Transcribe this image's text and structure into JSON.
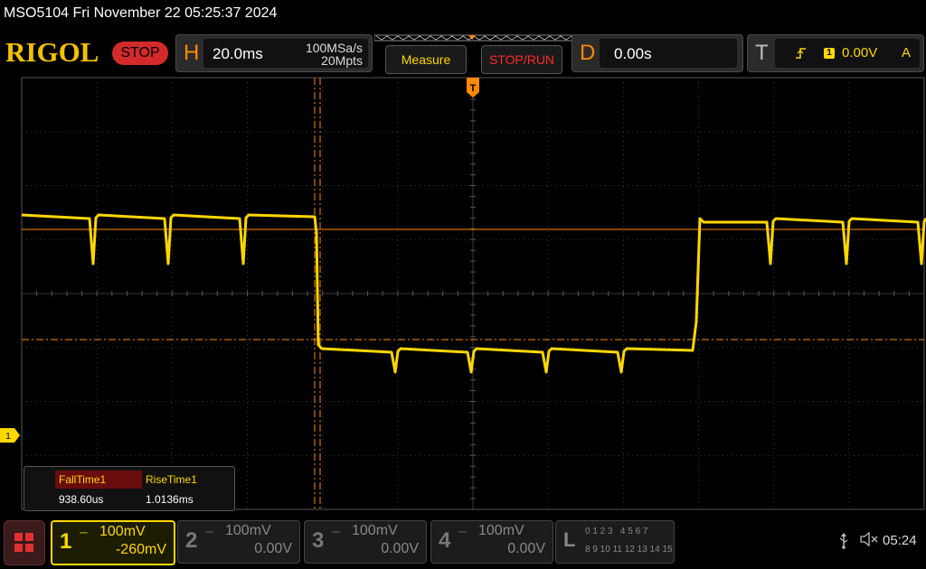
{
  "title": "MSO5104  Fri November 22 05:25:37 2024",
  "logo": "RIGOL",
  "run_state": "STOP",
  "horizontal": {
    "letter": "H",
    "timebase": "20.0ms",
    "sample_rate": "100MSa/s",
    "memory_depth": "20Mpts"
  },
  "menu": {
    "measure": "Measure",
    "stop_run": "STOP/RUN"
  },
  "delay": {
    "letter": "D",
    "value": "0.00s"
  },
  "trigger": {
    "letter": "T",
    "edge_icon": "rising-edge-icon",
    "source": "1",
    "level": "0.00V",
    "mode": "A"
  },
  "colors": {
    "ch1": "#ffd700",
    "cursor": "#ff8a00",
    "stop": "#d42a2a",
    "grid": "#444444"
  },
  "screen": {
    "ch1_marker": "1"
  },
  "measurements": {
    "fall_label": "FallTime1",
    "fall_value": "938.60us",
    "rise_label": "RiseTime1",
    "rise_value": "1.0136ms"
  },
  "channels": [
    {
      "num": "1",
      "scale": "100mV",
      "offset": "-260mV",
      "active": true
    },
    {
      "num": "2",
      "scale": "100mV",
      "offset": "0.00V",
      "active": false
    },
    {
      "num": "3",
      "scale": "100mV",
      "offset": "0.00V",
      "active": false
    },
    {
      "num": "4",
      "scale": "100mV",
      "offset": "0.00V",
      "active": false
    }
  ],
  "logic": {
    "letter": "L",
    "row1": "0 1 2 3   4 5 6 7",
    "row2": "8 9 10 11 12 13 14 15"
  },
  "clock": "05:24"
}
